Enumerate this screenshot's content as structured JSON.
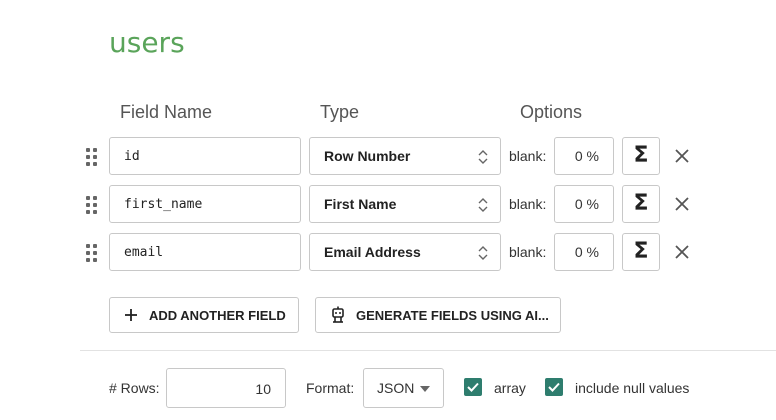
{
  "title": "users",
  "columns": {
    "field_name": "Field Name",
    "type": "Type",
    "options": "Options"
  },
  "fields": [
    {
      "name": "id",
      "type": "Row Number",
      "blank_label": "blank:",
      "blank_value": "0 %"
    },
    {
      "name": "first_name",
      "type": "First Name",
      "blank_label": "blank:",
      "blank_value": "0 %"
    },
    {
      "name": "email",
      "type": "Email Address",
      "blank_label": "blank:",
      "blank_value": "0 %"
    }
  ],
  "icons": {
    "drag": "drag-handle-icon",
    "updown": "updown-chevron-icon",
    "sigma": "sigma-icon",
    "close": "close-icon",
    "plus": "plus-icon",
    "robot": "robot-icon",
    "caret": "caret-down-icon",
    "check": "check-icon"
  },
  "sigma_glyph": "Σ",
  "buttons": {
    "add_field": "ADD ANOTHER FIELD",
    "generate": "GENERATE FIELDS USING AI..."
  },
  "footer": {
    "rows_label": "# Rows:",
    "rows_value": "10",
    "format_label": "Format:",
    "format_value": "JSON",
    "array_label": "array",
    "array_checked": true,
    "null_label": "include null values",
    "null_checked": true
  },
  "colors": {
    "title": "#5aa45a",
    "checkbox": "#2e7d6e"
  }
}
